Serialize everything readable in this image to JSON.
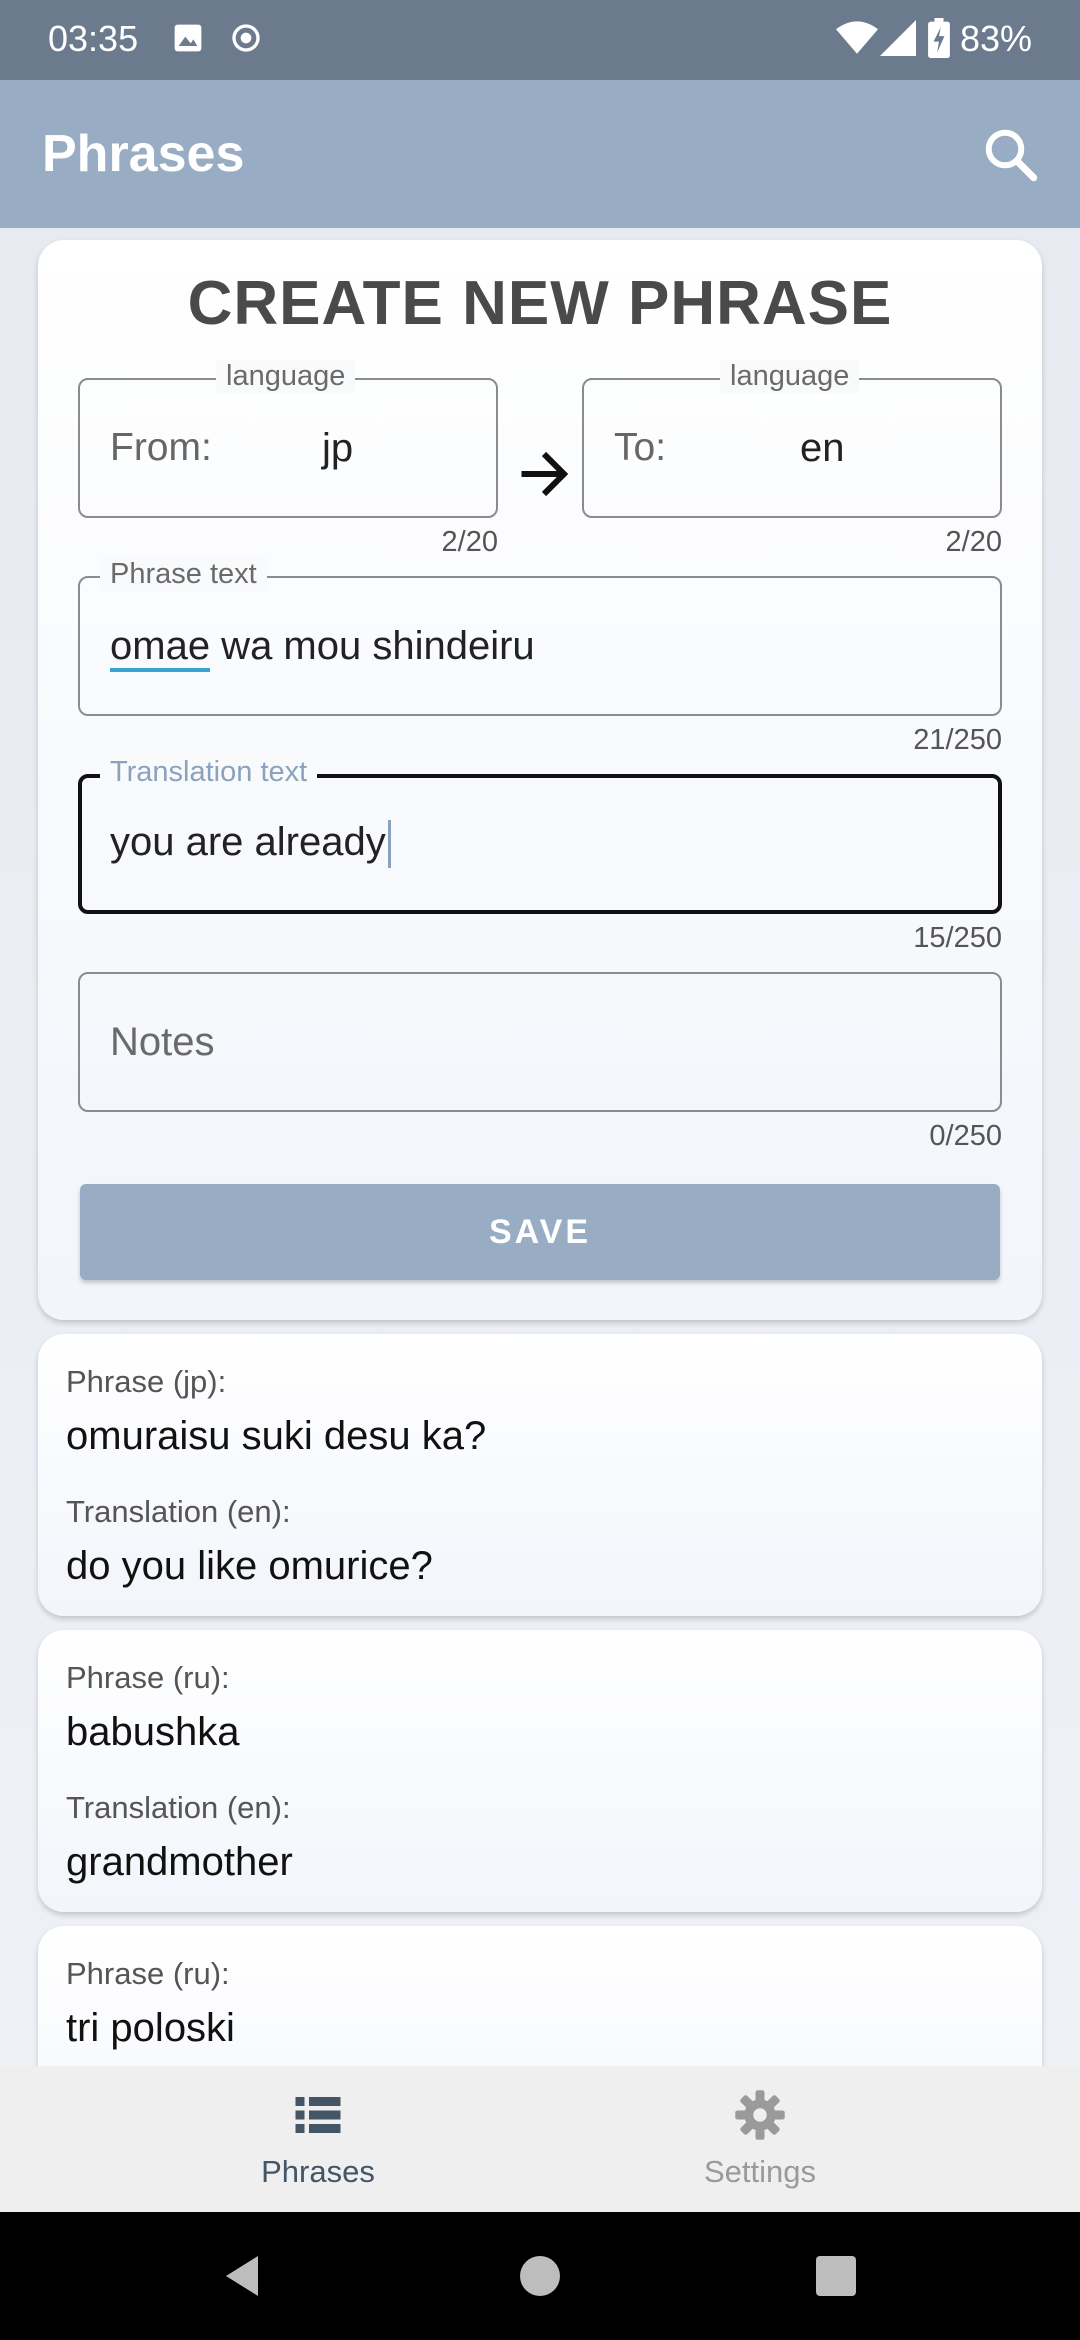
{
  "status_bar": {
    "time": "03:35",
    "battery": "83%"
  },
  "app_bar": {
    "title": "Phrases"
  },
  "create_form": {
    "title": "CREATE NEW PHRASE",
    "from": {
      "legend": "language",
      "prefix": "From:",
      "value": "jp",
      "counter": "2/20"
    },
    "to": {
      "legend": "language",
      "prefix": "To:",
      "value": "en",
      "counter": "2/20"
    },
    "phrase": {
      "legend": "Phrase text",
      "value_word1": "omae",
      "value_rest": " wa mou shindeiru",
      "counter": "21/250"
    },
    "translation": {
      "legend": "Translation text",
      "value": "you are already",
      "counter": "15/250"
    },
    "notes": {
      "placeholder": "Notes",
      "counter": "0/250"
    },
    "save_label": "SAVE"
  },
  "phrases": [
    {
      "phrase_label": "Phrase (jp):",
      "phrase": "omuraisu suki desu ka?",
      "translation_label": "Translation (en):",
      "translation": "do you like omurice?"
    },
    {
      "phrase_label": "Phrase (ru):",
      "phrase": "babushka",
      "translation_label": "Translation (en):",
      "translation": "grandmother"
    },
    {
      "phrase_label": "Phrase (ru):",
      "phrase": "tri poloski"
    }
  ],
  "bottom_nav": {
    "phrases": "Phrases",
    "settings": "Settings"
  },
  "colors": {
    "accent": "#98adc4",
    "status_bar": "#6c7a8e",
    "focus_label": "#8aa2bd"
  }
}
